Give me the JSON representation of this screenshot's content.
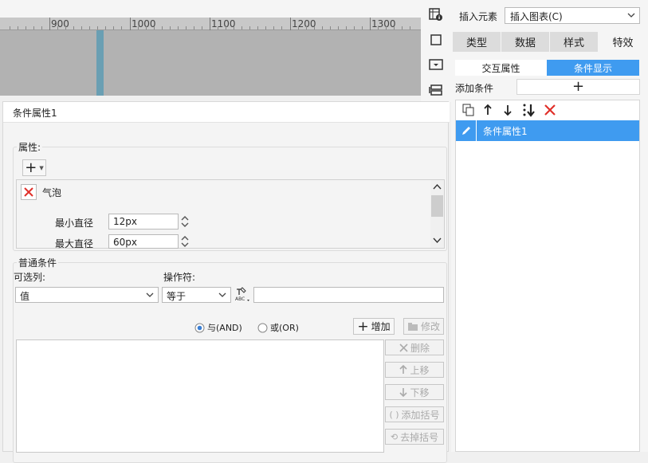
{
  "ruler": {
    "ticks": [
      "900",
      "1000",
      "1100",
      "1200",
      "1300"
    ]
  },
  "right_panel": {
    "insert_label": "插入元素",
    "insert_value": "插入图表(C)",
    "tabs": [
      "类型",
      "数据",
      "样式",
      "特效"
    ],
    "subtabs": [
      "交互属性",
      "条件显示"
    ],
    "add_condition_label": "添加条件",
    "list_items": [
      "条件属性1"
    ]
  },
  "dialog": {
    "title": "条件属性1",
    "attributes": {
      "legend": "属性:",
      "item_name": "气泡",
      "min_label": "最小直径",
      "min_value": "12px",
      "max_label": "最大直径",
      "max_value": "60px"
    },
    "conditions": {
      "legend": "普通条件",
      "column_label": "可选列:",
      "column_value": "值",
      "operator_label": "操作符:",
      "operator_value": "等于",
      "value_input": "",
      "and_label": "与(AND)",
      "or_label": "或(OR)",
      "add_button": "增加",
      "modify_button": "修改",
      "delete_button": "删除",
      "up_button": "上移",
      "down_button": "下移",
      "add_bracket_button": "添加括号",
      "remove_bracket_button": "去掉括号"
    }
  },
  "colors": {
    "accent": "#3f9bf0",
    "delete_red": "#e0302a",
    "marker": "#6a9fb3"
  }
}
